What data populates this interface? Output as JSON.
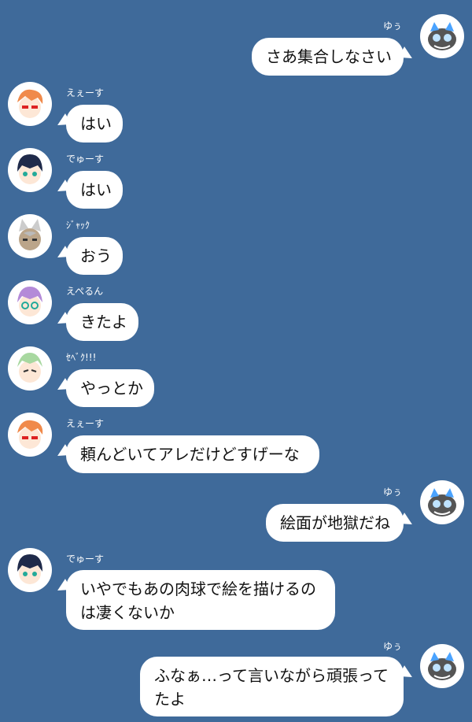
{
  "colors": {
    "background": "#3f6a9a",
    "bubble": "#ffffff",
    "name_text": "#ffffff"
  },
  "messages": [
    {
      "side": "right",
      "name": "ゆぅ",
      "avatar_icon": "gray-cat-monster-icon",
      "text": "さあ集合しなさい"
    },
    {
      "side": "left",
      "name": "えぇーす",
      "avatar_icon": "orange-hair-character-icon",
      "text": "はい"
    },
    {
      "side": "left",
      "name": "でゅーす",
      "avatar_icon": "dark-blue-hair-character-icon",
      "text": "はい"
    },
    {
      "side": "left",
      "name": "ｼﾞｬｯｸ",
      "avatar_icon": "wolf-ear-character-icon",
      "text": "おう"
    },
    {
      "side": "left",
      "name": "えぺるん",
      "avatar_icon": "purple-hair-character-icon",
      "text": "きたよ"
    },
    {
      "side": "left",
      "name": "ｾﾍﾞｸ!!!",
      "avatar_icon": "green-hair-character-icon",
      "text": "やっとか"
    },
    {
      "side": "left",
      "name": "えぇーす",
      "avatar_icon": "orange-hair-character-icon",
      "text": "頼んどいてアレだけどすげーな"
    },
    {
      "side": "right",
      "name": "ゆぅ",
      "avatar_icon": "gray-cat-monster-icon",
      "text": "絵面が地獄だね"
    },
    {
      "side": "left",
      "name": "でゅーす",
      "avatar_icon": "dark-blue-hair-character-icon",
      "text": "いやでもあの肉球で絵を描けるのは凄くないか"
    },
    {
      "side": "right",
      "name": "ゆぅ",
      "avatar_icon": "gray-cat-monster-icon",
      "text": "ふなぁ…って言いながら頑張ってたよ"
    }
  ]
}
